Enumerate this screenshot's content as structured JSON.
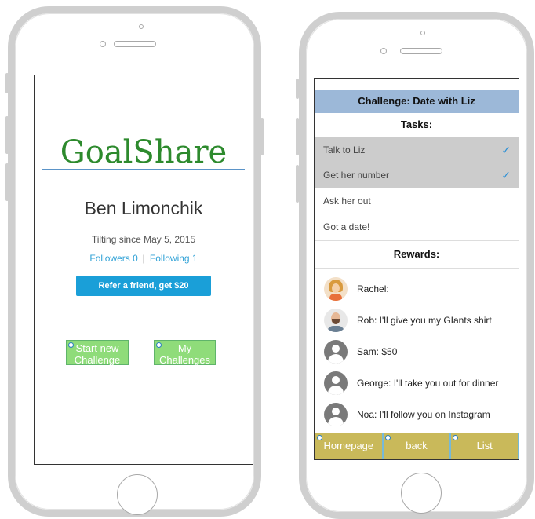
{
  "left_phone": {
    "app_name": "GoalShare",
    "user_name": "Ben Limonchik",
    "tilting_since": "Tilting since May 5, 2015",
    "followers": "Followers 0",
    "separator": "|",
    "following": "Following 1",
    "refer_button": "Refer a friend, get $20",
    "start_challenge_button": "Start new Challenge",
    "my_challenges_button": "My Challenges"
  },
  "right_phone": {
    "header_title": "Challenge: Date with Liz",
    "tasks_heading": "Tasks:",
    "tasks": [
      {
        "label": "Talk to Liz",
        "done": true
      },
      {
        "label": "Get her number",
        "done": true
      },
      {
        "label": "Ask her out",
        "done": false
      },
      {
        "label": "Got a date!",
        "done": false
      }
    ],
    "check_glyph": "✓",
    "rewards_heading": "Rewards:",
    "rewards": [
      {
        "text": "Rachel:",
        "avatar": "photo-woman"
      },
      {
        "text": "Rob: I'll give you my GIants shirt",
        "avatar": "photo-man"
      },
      {
        "text": "Sam: $50",
        "avatar": "generic-user-icon"
      },
      {
        "text": "George: I'll take you out for dinner",
        "avatar": "generic-user-icon"
      },
      {
        "text": "Noa: I'll follow you on Instagram",
        "avatar": "generic-user-icon"
      }
    ],
    "bottom_tabs": [
      "Homepage",
      "back",
      "List"
    ]
  },
  "colors": {
    "brand_green": "#2d8a2d",
    "link_blue": "#2fa1d6",
    "refer_button": "#1a9fd8",
    "green_button": "#8fdc7a",
    "header_blue": "#9cb8d8",
    "done_gray": "#cccccc",
    "bottom_bar": "#c9b95a"
  }
}
